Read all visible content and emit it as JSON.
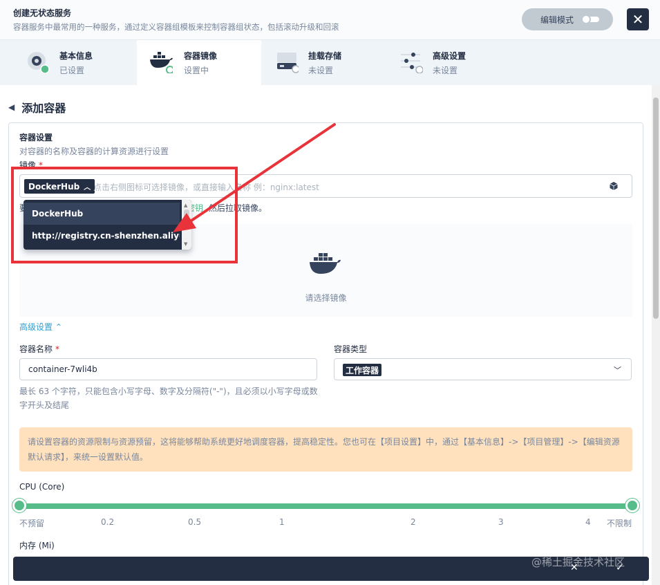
{
  "header": {
    "title": "创建无状态服务",
    "desc": "容器服务中最常用的一种服务，通过定义容器组模板来控制容器组状态，包括滚动升级和回滚",
    "edit_mode": "编辑模式",
    "close": "✕"
  },
  "steps": [
    {
      "name": "基本信息",
      "status": "已设置"
    },
    {
      "name": "容器镜像",
      "status": "设置中"
    },
    {
      "name": "挂载存储",
      "status": "未设置"
    },
    {
      "name": "高级设置",
      "status": "未设置"
    }
  ],
  "page": {
    "back": "◀",
    "title": "添加容器"
  },
  "container_settings": {
    "title": "容器设置",
    "desc": "对容器的名称及容器的计算资源进行设置",
    "image_label": "镜像",
    "required": "*",
    "registry": "DockerHub",
    "image_placeholder": "点击右侧图标可选择镜像，或直接输入名称 例：nginx:latest",
    "hint_prefix": "要",
    "hint_link": "密钥",
    "hint_suffix": "然后拉取镜像。",
    "empty_text": "请选择镜像",
    "advanced": "高级设置 ⌃"
  },
  "registry_dropdown": {
    "options": [
      "DockerHub",
      "http://registry.cn-shenzhen.aliyunc..."
    ]
  },
  "form": {
    "name_label": "容器名称",
    "name_value": "container-7wli4b",
    "type_label": "容器类型",
    "type_value": "工作容器",
    "name_hint": "最长 63 个字符，只能包含小写字母、数字及分隔符(\"-\")，且必须以小写字母或数字开头及结尾"
  },
  "warning": "请设置容器的资源限制与资源预留，这将能够帮助系统更好地调度容器，提高稳定性。您也可在【项目设置】中，通过【基本信息】->【项目管理】->【编辑资源默认请求】，来统一设置默认值。",
  "cpu": {
    "label": "CPU (Core)",
    "ticks": [
      "不预留",
      "0.2",
      "0.5",
      "1",
      "2",
      "3",
      "4",
      "不限制"
    ],
    "request_fraction": 0,
    "limit_fraction": 1
  },
  "memory": {
    "label": "内存 (Mi)"
  },
  "bottom": {
    "cancel": "✕",
    "ok": "✓"
  },
  "watermark": "@稀土掘金技术社区",
  "colors": {
    "primary_dark": "#242e42",
    "green": "#55bc8a",
    "annotation_red": "#e8333a"
  }
}
